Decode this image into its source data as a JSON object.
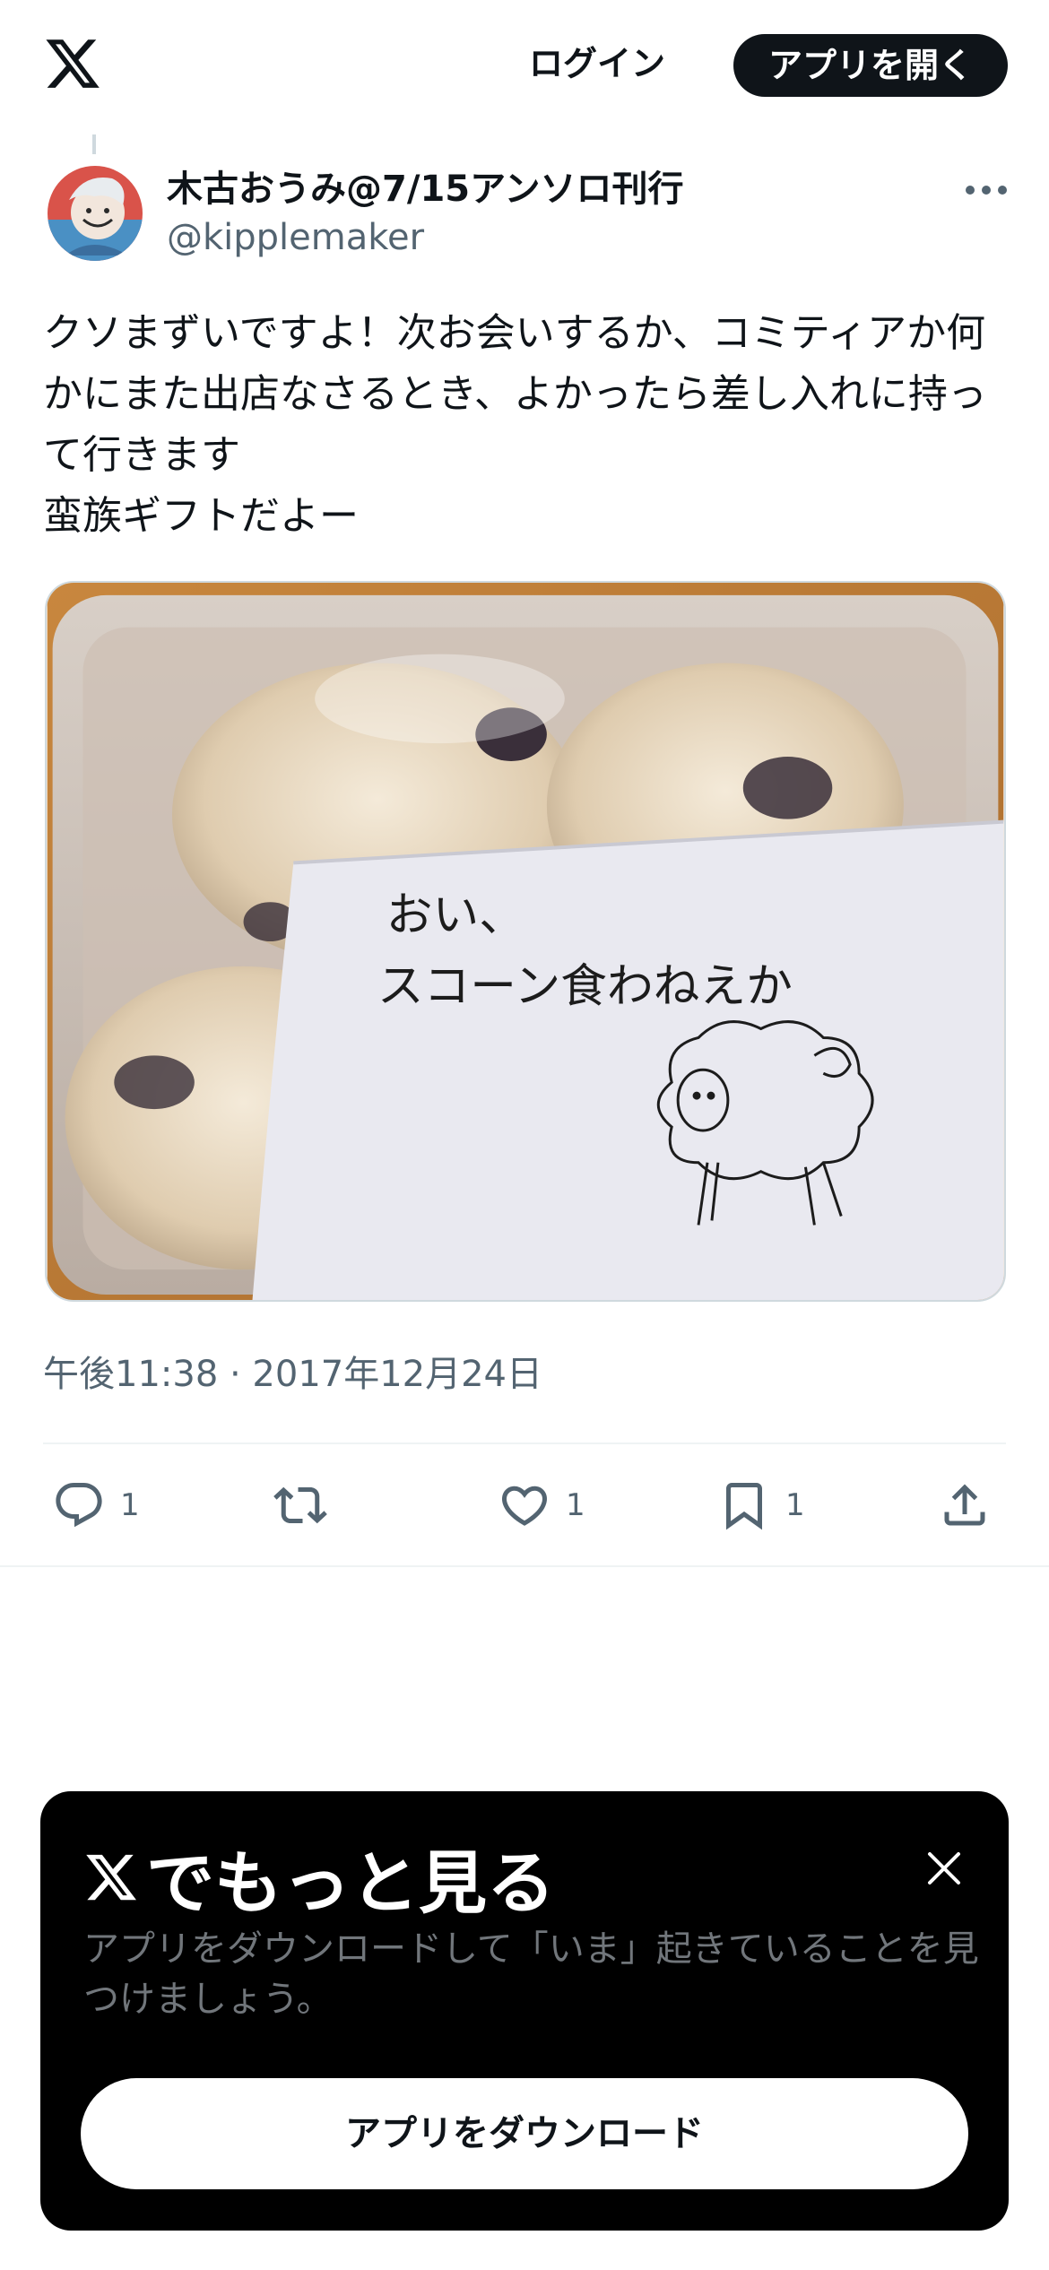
{
  "header": {
    "logo_icon": "x-logo-icon",
    "login_label": "ログイン",
    "open_app_label": "アプリを開く"
  },
  "tweet": {
    "display_name": "木古おうみ@7/15アンソロ刊行",
    "handle": "@kipplemaker",
    "text": "クソまずいですよ！次お会いするか、コミティアか何かにまた出店なさるとき、よかったら差し入れに持って行きます\n蛮族ギフトだよー",
    "timestamp": "午後11:38 · 2017年12月24日",
    "media": {
      "note_line1": "おい、",
      "note_line2": "スコーン食わねえか"
    },
    "actions": {
      "reply_count": "1",
      "repost_count": "",
      "like_count": "1",
      "bookmark_count": "1"
    }
  },
  "promo": {
    "title": "でもっと見る",
    "description": "アプリをダウンロードして「いま」起きていることを見つけましょう。",
    "button_label": "アプリをダウンロード"
  },
  "colors": {
    "text_primary": "#0f1419",
    "text_secondary": "#536471",
    "promo_bg": "#000000",
    "promo_desc": "#71767b"
  }
}
